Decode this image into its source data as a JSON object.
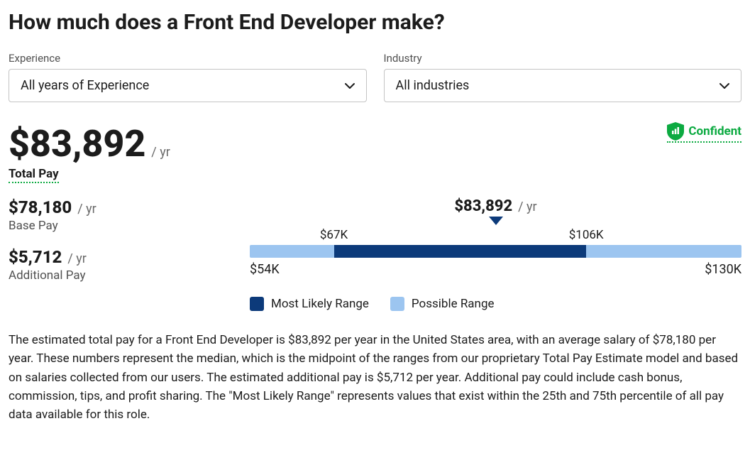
{
  "title": "How much does a Front End Developer make?",
  "filters": {
    "experience": {
      "label": "Experience",
      "value": "All years of Experience"
    },
    "industry": {
      "label": "Industry",
      "value": "All industries"
    }
  },
  "total_pay": {
    "amount": "$83,892",
    "unit": "/ yr",
    "label": "Total Pay"
  },
  "confident_label": "Confident",
  "breakdown": {
    "base": {
      "amount": "$78,180",
      "unit": "/ yr",
      "label": "Base Pay"
    },
    "additional": {
      "amount": "$5,712",
      "unit": "/ yr",
      "label": "Additional Pay"
    }
  },
  "chart_data": {
    "type": "bar",
    "median": {
      "value": "$83,892",
      "unit": "/ yr"
    },
    "likely_low": "$67K",
    "likely_high": "$106K",
    "min": "$54K",
    "max": "$130K",
    "range": [
      54,
      130
    ],
    "likely_range": [
      67,
      106
    ],
    "median_numeric": 83.892,
    "legend": {
      "likely": "Most Likely Range",
      "possible": "Possible Range"
    }
  },
  "description": "The estimated total pay for a Front End Developer is $83,892 per year in the United States area, with an average salary of $78,180 per year. These numbers represent the median, which is the midpoint of the ranges from our proprietary Total Pay Estimate model and based on salaries collected from our users. The estimated additional pay is $5,712 per year. Additional pay could include cash bonus, commission, tips, and profit sharing. The \"Most Likely Range\" represents values that exist within the 25th and 75th percentile of all pay data available for this role."
}
